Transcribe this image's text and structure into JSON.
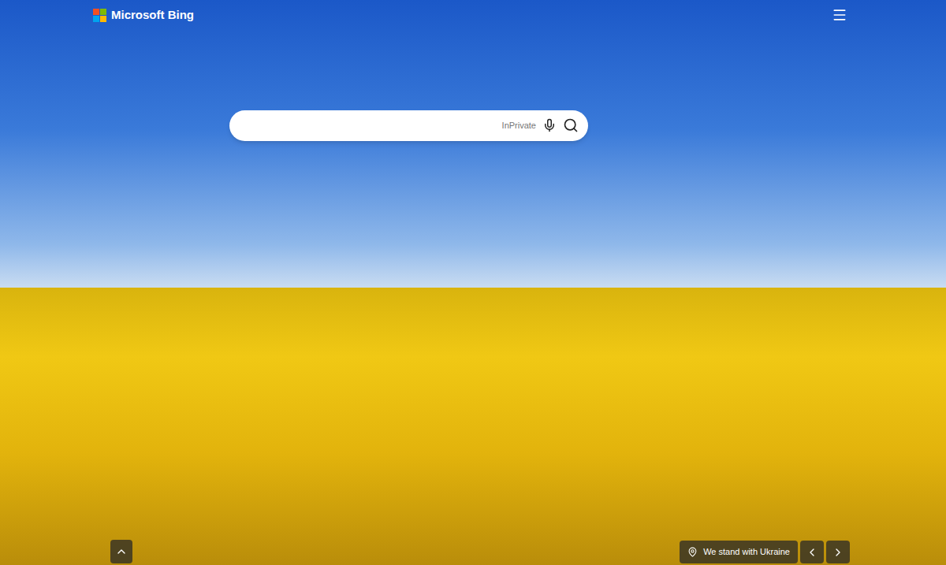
{
  "header": {
    "logo": "Microsoft Bing"
  },
  "search": {
    "placeholder": "",
    "badge": "InPrivate"
  },
  "caption": {
    "label": "We stand with Ukraine"
  }
}
